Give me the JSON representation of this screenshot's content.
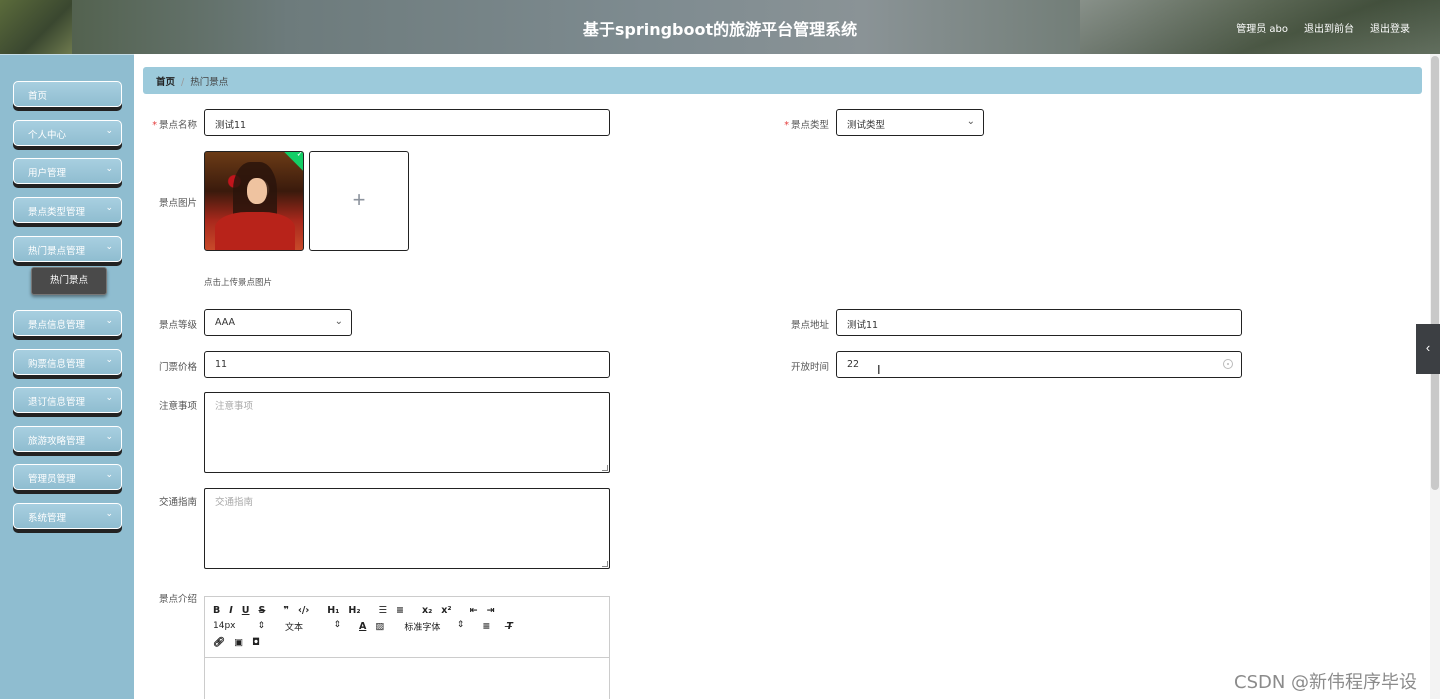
{
  "header": {
    "title": "基于springboot的旅游平台管理系统",
    "admin_label": "管理员 abo",
    "to_frontend": "退出到前台",
    "logout": "退出登录"
  },
  "sidebar": {
    "items": [
      {
        "label": "首页"
      },
      {
        "label": "个人中心"
      },
      {
        "label": "用户管理"
      },
      {
        "label": "景点类型管理"
      },
      {
        "label": "热门景点管理"
      },
      {
        "label": "景点信息管理"
      },
      {
        "label": "购票信息管理"
      },
      {
        "label": "退订信息管理"
      },
      {
        "label": "旅游攻略管理"
      },
      {
        "label": "管理员管理"
      },
      {
        "label": "系统管理"
      }
    ],
    "sub_item": "热门景点"
  },
  "breadcrumb": {
    "home": "首页",
    "current": "热门景点"
  },
  "form": {
    "name_label": "景点名称",
    "name_value": "测试11",
    "type_label": "景点类型",
    "type_value": "测试类型",
    "image_label": "景点图片",
    "upload_tip": "点击上传景点图片",
    "level_label": "景点等级",
    "level_value": "AAA",
    "address_label": "景点地址",
    "address_value": "测试11",
    "price_label": "门票价格",
    "price_value": "11",
    "open_label": "开放时间",
    "open_value": "22",
    "notice_label": "注意事项",
    "notice_placeholder": "注意事项",
    "traffic_label": "交通指南",
    "traffic_placeholder": "交通指南",
    "intro_label": "景点介绍"
  },
  "editor": {
    "font_size": "14px",
    "text_style": "文本",
    "font_family": "标准字体"
  },
  "watermark": "CSDN @新伟程序毕设",
  "colors": {
    "sidebar": "#8fbdd0",
    "breadcrumb": "#9ccadb",
    "required": "#e53c3c",
    "success": "#13ce66"
  }
}
